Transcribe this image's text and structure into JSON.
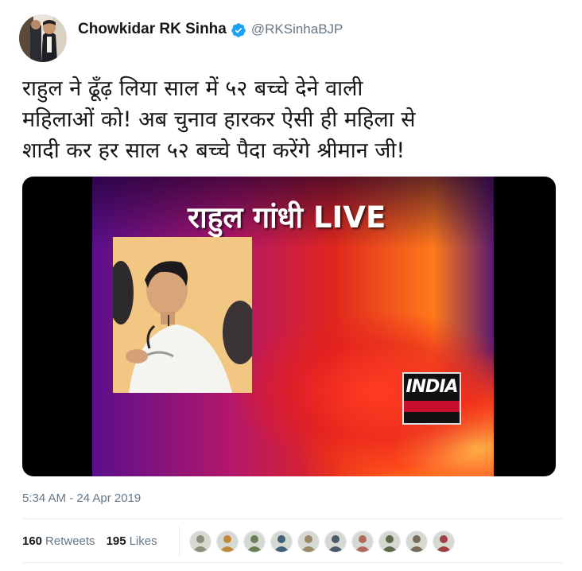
{
  "author": {
    "display_name": "Chowkidar RK Sinha",
    "handle": "@RKSinhaBJP",
    "avatar_icon": "user-avatar",
    "verified_icon": "verified-badge-icon",
    "verified_color": "#1da1f2"
  },
  "tweet": {
    "lines": [
      "राहुल ने ढूँढ़ लिया साल में ५२ बच्चे देने वाली",
      "महिलाओं को! अब चुनाव हारकर ऐसी ही महिला से",
      "शादी कर हर साल ५२ बच्चे पैदा करेंगे श्रीमान जी!"
    ]
  },
  "media": {
    "overlay_title": "राहुल गांधी LIVE",
    "logo_text": "INDIA"
  },
  "timestamp": "5:34 AM - 24 Apr 2019",
  "stats": {
    "retweets_count": "160",
    "retweets_label": "Retweets",
    "likes_count": "195",
    "likes_label": "Likes"
  },
  "likers": [
    {
      "icon": "liker-avatar-1",
      "color": "#8a8f7a"
    },
    {
      "icon": "liker-avatar-2",
      "color": "#c08a3a"
    },
    {
      "icon": "liker-avatar-3",
      "color": "#6a7d55"
    },
    {
      "icon": "liker-avatar-4",
      "color": "#3f5f7a"
    },
    {
      "icon": "liker-avatar-5",
      "color": "#9a8a6a"
    },
    {
      "icon": "liker-avatar-6",
      "color": "#4a5a6a"
    },
    {
      "icon": "liker-avatar-7",
      "color": "#b06a5a"
    },
    {
      "icon": "liker-avatar-8",
      "color": "#5a6a4a"
    },
    {
      "icon": "liker-avatar-9",
      "color": "#7a6a5a"
    },
    {
      "icon": "liker-avatar-10",
      "color": "#a04040"
    }
  ]
}
